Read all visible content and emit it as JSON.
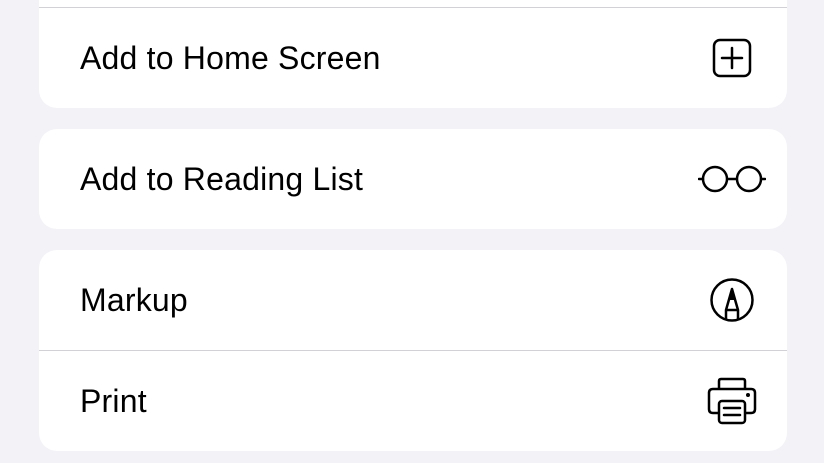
{
  "menu": {
    "items": [
      {
        "label": "Add to Home Screen",
        "icon": "add-square-icon"
      },
      {
        "label": "Add to Reading List",
        "icon": "glasses-icon"
      },
      {
        "label": "Markup",
        "icon": "markup-pen-icon"
      },
      {
        "label": "Print",
        "icon": "printer-icon"
      }
    ]
  },
  "colors": {
    "background": "#f2f2f7",
    "card": "#ffffff",
    "divider": "#d1d1d6",
    "text": "#000000"
  }
}
